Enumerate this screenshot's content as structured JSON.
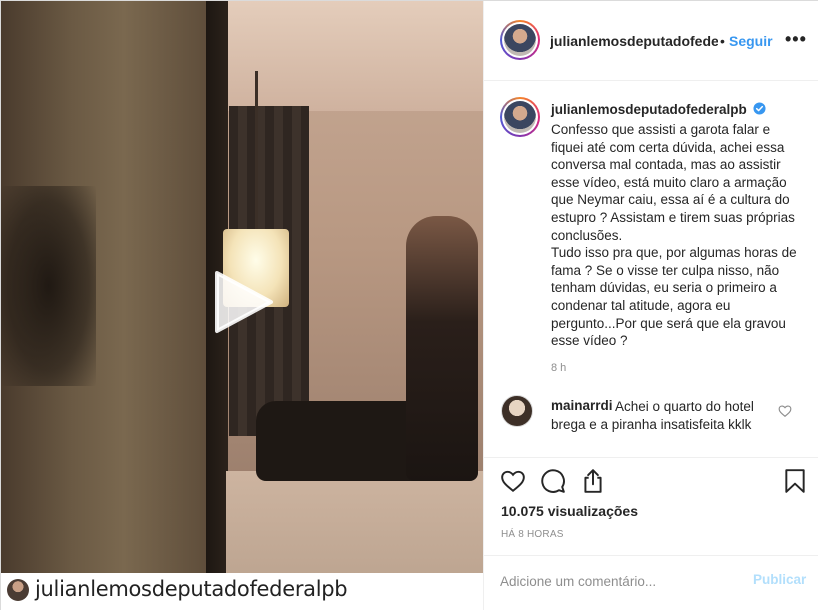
{
  "video": {
    "overlay_username": "julianlemosdeputadofederalpb"
  },
  "post": {
    "header": {
      "username": "julianlemosdeputadofeder",
      "separator": "•",
      "follow_label": "Seguir",
      "more_label": "•••"
    },
    "caption": {
      "username": "julianlemosdeputadofederalpb",
      "verified": true,
      "text": "Confesso que assisti a garota falar e fiquei até com certa dúvida, achei essa conversa mal contada, mas ao assistir esse vídeo, está muito claro a armação que Neymar caiu, essa aí é a cultura do estupro ? Assistam e tirem suas próprias conclusões.\nTudo isso pra que, por algumas horas de fama ? Se o visse ter culpa nisso, não tenham dúvidas, eu seria o primeiro a condenar tal atitude, agora eu pergunto...Por que será que ela gravou esse vídeo ?",
      "time": "8 h"
    },
    "comments": [
      {
        "username": "mainarrdi",
        "text": "Achei o quarto do hotel brega e a piranha insatisfeita kklk"
      }
    ],
    "actions": {
      "icons": [
        "heart-icon",
        "comment-icon",
        "share-icon",
        "bookmark-icon"
      ]
    },
    "views": "10.075 visualizações",
    "posted_ago": "HÁ 8 HORAS",
    "add_comment": {
      "placeholder": "Adicione um comentário...",
      "publish_label": "Publicar"
    }
  },
  "colors": {
    "link": "#3897f0",
    "publish_disabled": "#b2dffc",
    "muted": "#8e8e8e",
    "text": "#262626"
  }
}
